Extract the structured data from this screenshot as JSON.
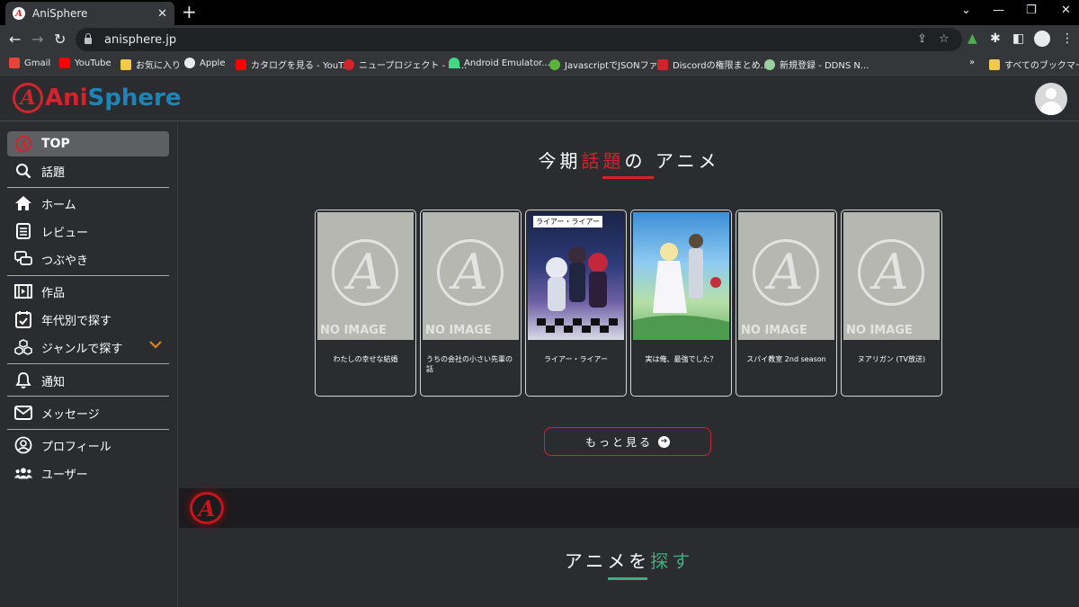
{
  "browser": {
    "tab_title": "AniSphere",
    "url": "anisphere.jp",
    "bookmarks": [
      {
        "label": "Gmail",
        "color": "#ea4335"
      },
      {
        "label": "YouTube",
        "color": "#ff0000"
      },
      {
        "label": "お気に入り",
        "color": "#f2c94c"
      },
      {
        "label": "Apple",
        "color": "#e8eaed"
      },
      {
        "label": "カタログを見る - YouT...",
        "color": "#ff0000"
      },
      {
        "label": "ニュープロジェクト - Mi...",
        "color": "#d4232b"
      },
      {
        "label": "Android Emulator...",
        "color": "#3ddc84"
      },
      {
        "label": "JavascriptでJSONファ...",
        "color": "#5bb33a"
      },
      {
        "label": "Discordの権限まとめ...",
        "color": "#d4232b"
      },
      {
        "label": "新規登録 - DDNS N...",
        "color": "#9ad0a0"
      }
    ],
    "more_bookmarks": "»",
    "all_bookmarks": "すべてのブックマーク"
  },
  "app": {
    "logo_letter": "A",
    "logo_part1": "Ani",
    "logo_part2": "Sphere"
  },
  "sidebar": {
    "items": [
      {
        "label": "TOP",
        "icon": "anisphere-logo-icon"
      },
      {
        "label": "話題",
        "icon": "search-icon"
      },
      {
        "label": "ホーム",
        "icon": "home-icon"
      },
      {
        "label": "レビュー",
        "icon": "newspaper-icon"
      },
      {
        "label": "つぶやき",
        "icon": "chat-icon"
      },
      {
        "label": "作品",
        "icon": "film-icon"
      },
      {
        "label": "年代別で探す",
        "icon": "calendar-check-icon"
      },
      {
        "label": "ジャンルで探す",
        "icon": "cubes-icon"
      },
      {
        "label": "通知",
        "icon": "bell-icon"
      },
      {
        "label": "メッセージ",
        "icon": "envelope-icon"
      },
      {
        "label": "プロフィール",
        "icon": "user-circle-icon"
      },
      {
        "label": "ユーザー",
        "icon": "users-icon"
      }
    ]
  },
  "trending": {
    "title_pre": "今期",
    "title_hl": "話題",
    "title_post": "の アニメ",
    "no_image_text": "NO IMAGE",
    "no_image_letter": "A",
    "cards": [
      {
        "title": "わたしの幸せな結婚",
        "has_image": false
      },
      {
        "title": "うちの会社の小さい先輩の話",
        "has_image": false
      },
      {
        "title": "ライアー・ライアー",
        "has_image": true,
        "poster_caption": "ライアー・ライアー"
      },
      {
        "title": "実は俺、最強でした？",
        "has_image": true
      },
      {
        "title": "スパイ教室 2nd season",
        "has_image": false
      },
      {
        "title": "ヌアリガン (TV放送)",
        "has_image": false
      }
    ],
    "more_label": "もっと見る",
    "more_arrow": "➔"
  },
  "search_section": {
    "title_pre": "アニメを",
    "title_hl": "探す"
  },
  "colors": {
    "accent_red": "#d4232b",
    "accent_blue": "#1b84b8",
    "accent_green": "#3fae7c",
    "chevron_orange": "#e58a1f"
  }
}
